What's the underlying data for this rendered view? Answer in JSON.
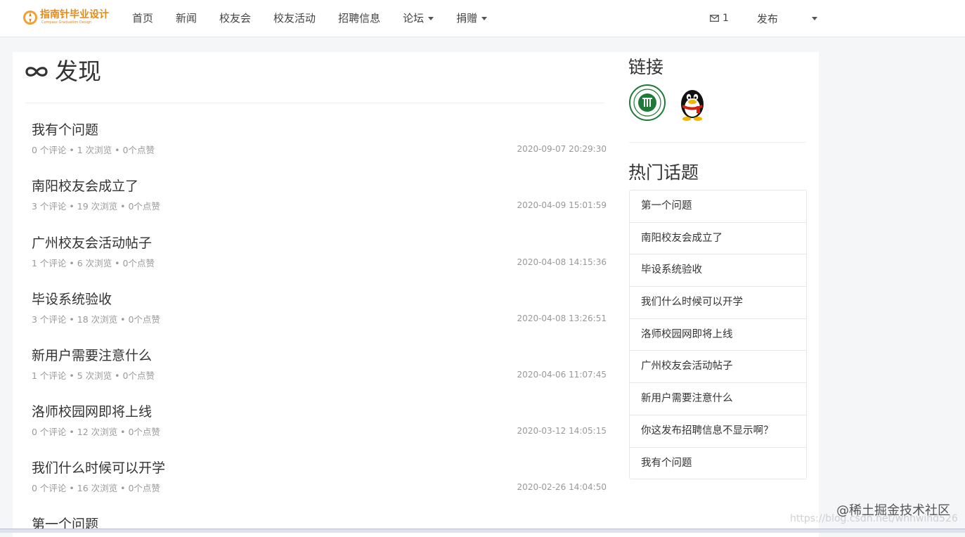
{
  "header": {
    "logo_text": "指南针毕业设计",
    "logo_sub": "Compass Graduation Design",
    "nav": [
      {
        "label": "首页"
      },
      {
        "label": "新闻"
      },
      {
        "label": "校友会"
      },
      {
        "label": "校友活动"
      },
      {
        "label": "招聘信息"
      },
      {
        "label": "论坛"
      },
      {
        "label": "捐赠"
      }
    ],
    "messages_count": "1",
    "publish_label": "发布"
  },
  "main": {
    "title": "发现",
    "posts": [
      {
        "title": "我有个问题",
        "meta": "0 个评论 • 1 次浏览 • 0个点赞",
        "date": "2020-09-07 20:29:30"
      },
      {
        "title": "南阳校友会成立了",
        "meta": "3 个评论 • 19 次浏览 • 0个点赞",
        "date": "2020-04-09 15:01:59"
      },
      {
        "title": "广州校友会活动帖子",
        "meta": "1 个评论 • 6 次浏览 • 0个点赞",
        "date": "2020-04-08 14:15:36"
      },
      {
        "title": "毕设系统验收",
        "meta": "3 个评论 • 18 次浏览 • 0个点赞",
        "date": "2020-04-08 13:26:51"
      },
      {
        "title": "新用户需要注意什么",
        "meta": "1 个评论 • 5 次浏览 • 0个点赞",
        "date": "2020-04-06 11:07:45"
      },
      {
        "title": "洛师校园网即将上线",
        "meta": "0 个评论 • 12 次浏览 • 0个点赞",
        "date": "2020-03-12 14:05:15"
      },
      {
        "title": "我们什么时候可以开学",
        "meta": "0 个评论 • 16 次浏览 • 0个点赞",
        "date": "2020-02-26 14:04:50"
      },
      {
        "title": "第一个问题",
        "meta": "",
        "date": ""
      }
    ]
  },
  "sidebar": {
    "links_title": "链接",
    "hot_title": "热门话题",
    "hot_topics": [
      {
        "label": "第一个问题"
      },
      {
        "label": "南阳校友会成立了"
      },
      {
        "label": "毕设系统验收"
      },
      {
        "label": "我们什么时候可以开学"
      },
      {
        "label": "洛师校园网即将上线"
      },
      {
        "label": "广州校友会活动帖子"
      },
      {
        "label": "新用户需要注意什么"
      },
      {
        "label": "你这发布招聘信息不显示啊？"
      },
      {
        "label": "我有个问题"
      }
    ]
  },
  "watermark": "@稀土掘金技术社区",
  "watermark_url": "https://blog.csdn.net/whhwind526",
  "colors": {
    "accent": "#e38b1b",
    "text": "#333333",
    "muted": "#999999"
  }
}
